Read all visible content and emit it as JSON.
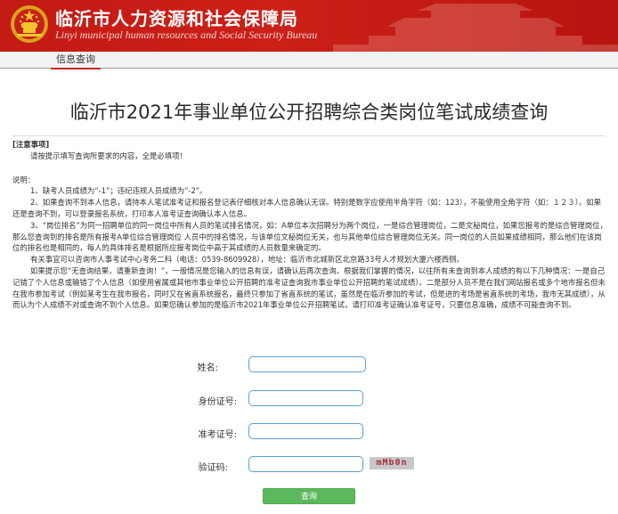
{
  "header": {
    "title": "临沂市人力资源和社会保障局",
    "subtitle": "Linyi municipal human resources and Social Security Bureau"
  },
  "nav": {
    "tab_label": "信息查询"
  },
  "page": {
    "title": "临沂市2021年事业单位公开招聘综合类岗位笔试成绩查询"
  },
  "notes": {
    "heading": "[注意事项]",
    "intro": "请按提示填写查询所要求的内容，全是必填项！",
    "label": "说明：",
    "item1": "1、缺考人员成绩为“-1”；违纪违规人员成绩为“-2”。",
    "item2": "2、如果查询不到本人信息，请持本人笔试准考证和报名登记表仔细核对本人信息确认无误。特别是数字应使用半角字符（如：123），不能使用全角字符（如：１２３）。如果还是查询不到，可以登录报名系统，打印本人准考证查询确认本人信息。",
    "item3": "3、“岗位排名”为同一招聘单位的同一岗位中所有人员的笔试排名情况，如：A单位本次招聘分为两个岗位，一是综合管理岗位，二是文秘岗位，如果您报考的是综合管理岗位，那么您查询到的排名是所有报考A单位综合管理岗位 人员中的排名情况，与该单位文秘岗位无关，也与其他单位综合管理岗位无关。同一岗位的人员如果成绩相同，那么他们在该岗位的排名也是相同的，每人的具体排名是根据所应报考岗位中高于其成绩的人员数量来确定的。",
    "contact": "有关事宜可以咨询市人事考试中心考务二科（电话：0539-8609928），地址：临沂市北城新区北京路33号人才规划大厦六楼西侧。",
    "note": "如果提示您“无查询结果，请重新查询！”，一般情况是您输入的信息有误，请确认后再次查询。根据我们掌握的情况，以往所有未查询到本人成绩的有以下几种情况：一是自己记错了个人信息或输错了个人信息（如使用省属或其他市事业单位公开招聘的准考证查询我市事业单位公开招聘的笔试成绩）。二是部分人员不是在我们网站报名或多个地市报名但未在我市参加考试（例如某考生在我市报名，同时又在省直系统报名，最终只参加了省直系统的笔试，虽然是在临沂参加的考试，但是进的考场是省直系统的考场，我市无其成绩），从而认为个人成绩不对或查询不到个人信息。如果您确认参加的是临沂市2021年事业单位公开招聘笔试，请打印准考证确认准考证号，只要信息准确，成绩不可能查询不到。"
  },
  "form": {
    "name_label": "姓名:",
    "id_label": "身份证号:",
    "ticket_label": "准考证号:",
    "captcha_label": "验证码:",
    "captcha_text": "mMb0n",
    "submit_label": "查询"
  },
  "colors": {
    "header_red": "#c41a14",
    "input_border": "#5aa0d8",
    "submit_green": "#5cb85c",
    "captcha_text": "#a52d3c"
  }
}
